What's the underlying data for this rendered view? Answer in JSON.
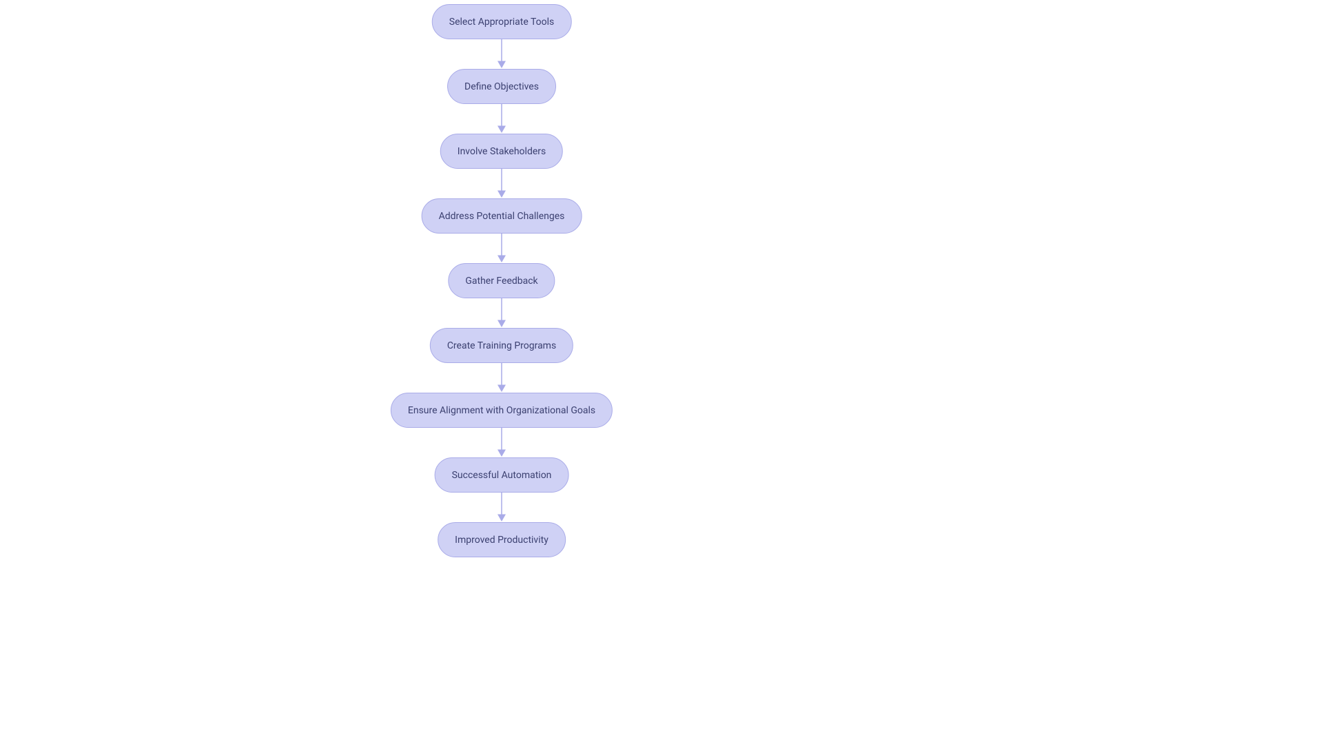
{
  "flow": {
    "centerX": 728,
    "nodeHeight": 51,
    "gap": 43,
    "startY": 6,
    "nodes": [
      {
        "label": "Select Appropriate Tools"
      },
      {
        "label": "Define Objectives"
      },
      {
        "label": "Involve Stakeholders"
      },
      {
        "label": "Address Potential Challenges"
      },
      {
        "label": "Gather Feedback"
      },
      {
        "label": "Create Training Programs"
      },
      {
        "label": "Ensure Alignment with Organizational Goals"
      },
      {
        "label": "Successful Automation"
      },
      {
        "label": "Improved Productivity"
      }
    ],
    "arrowColor": "#a9abe8"
  }
}
